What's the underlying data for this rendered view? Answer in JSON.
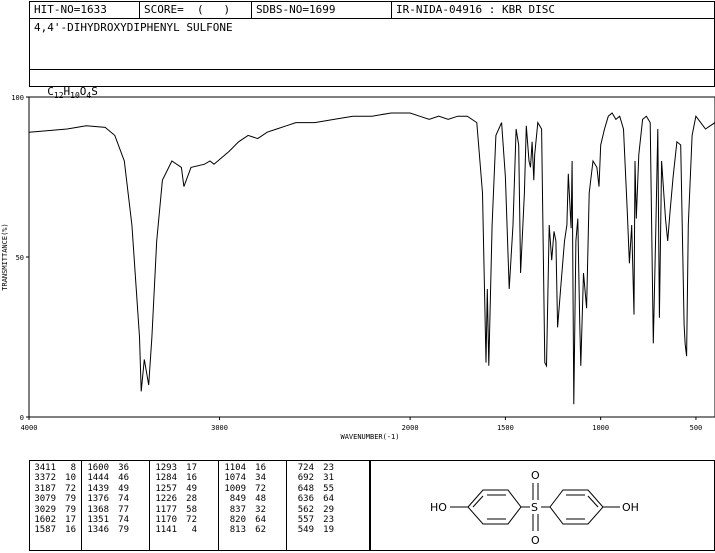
{
  "header": {
    "hit_no": "HIT-NO=1633",
    "score": "SCORE=  (   )",
    "sdbs_no": "SDBS-NO=1699",
    "ir_nida": "IR-NIDA-04916 : KBR DISC"
  },
  "compound": {
    "name": "4,4'-DIHYDROXYDIPHENYL SULFONE",
    "formula_parts": [
      "C",
      "12",
      "H",
      "10",
      "O",
      "4",
      "S"
    ]
  },
  "chart_data": {
    "type": "line",
    "xlabel": "WAVENUMBER(-1)",
    "ylabel": "TRANSMITTANCE(%)",
    "xlim": [
      4000,
      400
    ],
    "ylim": [
      0,
      100
    ],
    "x_ticks": [
      4000,
      3000,
      2000,
      1500,
      1000,
      500
    ],
    "y_ticks": [
      0,
      50,
      100
    ],
    "x_tick_labels": [
      "4000",
      "3000",
      "2000",
      "1500",
      "1000",
      "500"
    ],
    "y_tick_labels": [
      "0",
      "50",
      "100"
    ],
    "series": [
      {
        "x": [
          4000,
          3900,
          3800,
          3700,
          3600,
          3550,
          3500,
          3460,
          3420,
          3411,
          3395,
          3372,
          3355,
          3330,
          3300,
          3250,
          3200,
          3187,
          3150,
          3079,
          3050,
          3029,
          2950,
          2900,
          2850,
          2800,
          2750,
          2700,
          2650,
          2600,
          2500,
          2400,
          2300,
          2200,
          2100,
          2000,
          1950,
          1900,
          1850,
          1800,
          1750,
          1700,
          1650,
          1620,
          1602,
          1595,
          1587,
          1570,
          1550,
          1520,
          1500,
          1480,
          1460,
          1444,
          1430,
          1420,
          1400,
          1390,
          1376,
          1368,
          1360,
          1351,
          1346,
          1330,
          1310,
          1293,
          1284,
          1270,
          1257,
          1245,
          1235,
          1226,
          1210,
          1190,
          1177,
          1170,
          1155,
          1150,
          1141,
          1130,
          1120,
          1110,
          1104,
          1090,
          1074,
          1060,
          1040,
          1020,
          1009,
          1000,
          980,
          960,
          940,
          920,
          900,
          880,
          860,
          849,
          837,
          825,
          820,
          813,
          800,
          780,
          760,
          740,
          724,
          710,
          700,
          692,
          680,
          660,
          648,
          636,
          620,
          600,
          580,
          562,
          557,
          549,
          540,
          520,
          500,
          450,
          400
        ],
        "y": [
          89,
          89.5,
          90,
          91,
          90.5,
          88,
          80,
          60,
          25,
          8,
          18,
          10,
          25,
          55,
          74,
          80,
          78,
          72,
          78,
          79,
          80,
          79,
          83,
          86,
          88,
          87,
          89,
          90,
          91,
          92,
          92,
          93,
          94,
          94,
          95,
          95,
          94,
          93,
          94,
          93,
          94,
          94,
          92,
          70,
          17,
          40,
          16,
          60,
          88,
          92,
          75,
          40,
          60,
          90,
          85,
          45,
          70,
          91,
          80,
          78,
          86,
          74,
          82,
          92,
          90,
          17,
          16,
          60,
          49,
          58,
          55,
          28,
          40,
          55,
          60,
          76,
          59,
          80,
          4,
          55,
          62,
          30,
          16,
          45,
          34,
          70,
          80,
          78,
          72,
          85,
          90,
          94,
          95,
          93,
          94,
          90,
          64,
          48,
          60,
          32,
          80,
          62,
          82,
          93,
          94,
          92,
          23,
          60,
          90,
          31,
          80,
          62,
          55,
          64,
          75,
          86,
          85,
          29,
          23,
          19,
          60,
          88,
          94,
          90,
          92
        ]
      }
    ]
  },
  "peaks": [
    [
      [
        "3411",
        "8"
      ],
      [
        "3372",
        "10"
      ],
      [
        "3187",
        "72"
      ],
      [
        "3079",
        "79"
      ],
      [
        "3029",
        "79"
      ],
      [
        "1602",
        "17"
      ],
      [
        "1587",
        "16"
      ]
    ],
    [
      [
        "1600",
        "36"
      ],
      [
        "1444",
        "46"
      ],
      [
        "1439",
        "49"
      ],
      [
        "1376",
        "74"
      ],
      [
        "1368",
        "77"
      ],
      [
        "1351",
        "74"
      ],
      [
        "1346",
        "79"
      ]
    ],
    [
      [
        "1293",
        "17"
      ],
      [
        "1284",
        "16"
      ],
      [
        "1257",
        "49"
      ],
      [
        "1226",
        "28"
      ],
      [
        "1177",
        "58"
      ],
      [
        "1170",
        "72"
      ],
      [
        "1141",
        "4"
      ]
    ],
    [
      [
        "1104",
        "16"
      ],
      [
        "1074",
        "34"
      ],
      [
        "1009",
        "72"
      ],
      [
        "849",
        "48"
      ],
      [
        "837",
        "32"
      ],
      [
        "820",
        "64"
      ],
      [
        "813",
        "62"
      ]
    ],
    [
      [
        "724",
        "23"
      ],
      [
        "692",
        "31"
      ],
      [
        "648",
        "55"
      ],
      [
        "636",
        "64"
      ],
      [
        "562",
        "29"
      ],
      [
        "557",
        "23"
      ],
      [
        "549",
        "19"
      ]
    ]
  ],
  "structure": {
    "left_group": "HO",
    "right_group": "OH",
    "center_atom": "S",
    "oxygen_top": "O",
    "oxygen_bottom": "O"
  }
}
